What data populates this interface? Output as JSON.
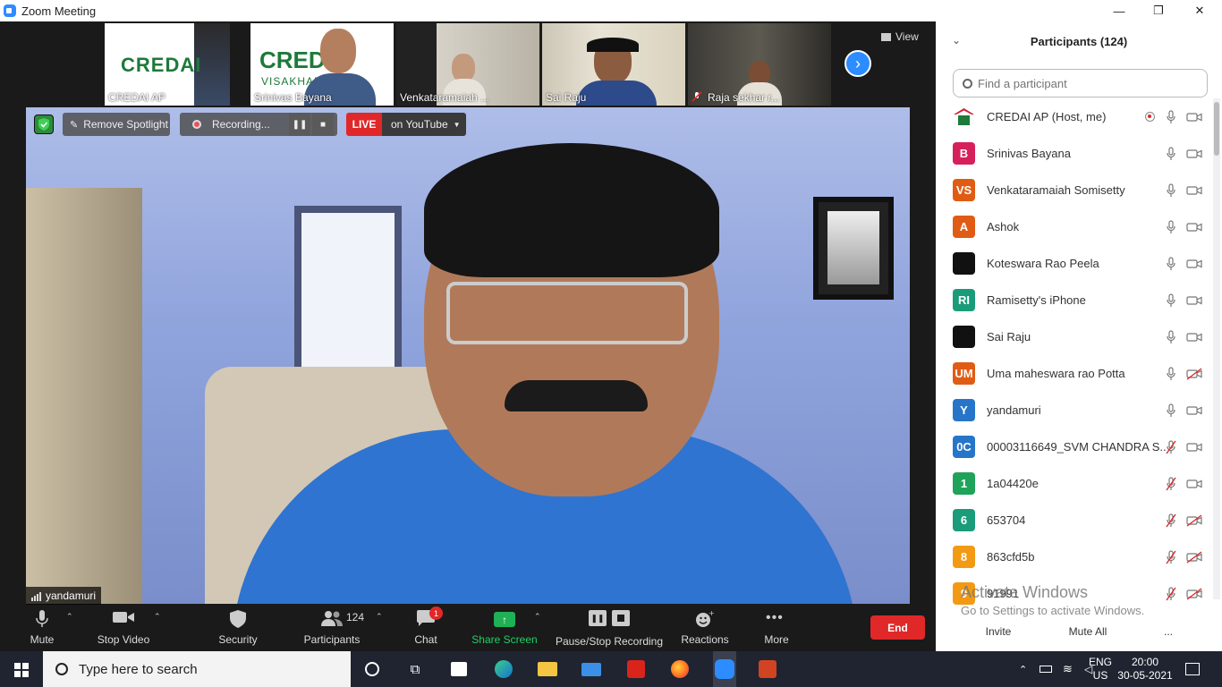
{
  "window": {
    "title": "Zoom Meeting",
    "min": "—",
    "max": "❐",
    "close": "✕"
  },
  "thumbnails": [
    {
      "name": "CREDAI AP",
      "logo": "CREDAI"
    },
    {
      "name": "Srinivas Bayana",
      "logo": "CREDAI",
      "sub": "VISAKHAPATNAM"
    },
    {
      "name": "Venkataramaiah ..."
    },
    {
      "name": "Sai Raju"
    },
    {
      "name": "Raja sekhar r..."
    }
  ],
  "view_label": "View",
  "spotlight": {
    "remove_label": "Remove Spotlight",
    "recording_label": "Recording...",
    "live_label": "LIVE",
    "youtube_label": "on YouTube"
  },
  "main_video_name": "yandamuri",
  "toolbar": {
    "mute": "Mute",
    "stop_video": "Stop Video",
    "security": "Security",
    "participants": "Participants",
    "participants_count": "124",
    "chat": "Chat",
    "chat_badge": "1",
    "share_screen": "Share Screen",
    "pause_stop_recording": "Pause/Stop Recording",
    "reactions": "Reactions",
    "more": "More",
    "end": "End"
  },
  "panel": {
    "title": "Participants (124)",
    "search_placeholder": "Find a participant",
    "participants": [
      {
        "initials": "",
        "name": "CREDAI AP (Host, me)",
        "color": "#ffffff",
        "mic": "on",
        "cam": "on",
        "rec": true,
        "logo": true
      },
      {
        "initials": "B",
        "name": "Srinivas Bayana",
        "color": "#d6205b",
        "mic": "on",
        "cam": "on"
      },
      {
        "initials": "VS",
        "name": "Venkataramaiah Somisetty",
        "color": "#e05c14",
        "mic": "on",
        "cam": "on"
      },
      {
        "initials": "A",
        "name": "Ashok",
        "color": "#e05c14",
        "mic": "on",
        "cam": "on"
      },
      {
        "initials": "",
        "name": "Koteswara Rao Peela",
        "color": "#111111",
        "mic": "on",
        "cam": "on"
      },
      {
        "initials": "RI",
        "name": "Ramisetty's iPhone",
        "color": "#1a9c7a",
        "mic": "on",
        "cam": "on"
      },
      {
        "initials": "",
        "name": "Sai Raju",
        "color": "#111111",
        "mic": "on",
        "cam": "on"
      },
      {
        "initials": "UM",
        "name": "Uma maheswara rao Potta",
        "color": "#e05c14",
        "mic": "on",
        "cam": "off"
      },
      {
        "initials": "Y",
        "name": "yandamuri",
        "color": "#2675c9",
        "mic": "on",
        "cam": "on"
      },
      {
        "initials": "0C",
        "name": "00003116649_SVM CHANDRA S...",
        "color": "#2675c9",
        "mic": "off",
        "cam": "on"
      },
      {
        "initials": "1",
        "name": "1a04420e",
        "color": "#1fa35a",
        "mic": "off",
        "cam": "on"
      },
      {
        "initials": "6",
        "name": "653704",
        "color": "#1a9c7a",
        "mic": "off",
        "cam": "off"
      },
      {
        "initials": "8",
        "name": "863cfd5b",
        "color": "#f29a14",
        "mic": "off",
        "cam": "off"
      },
      {
        "initials": "9",
        "name": "91991",
        "color": "#f29a14",
        "mic": "off",
        "cam": "off"
      }
    ],
    "invite": "Invite",
    "mute_all": "Mute All",
    "more": "..."
  },
  "activate_windows": {
    "line1": "Activate Windows",
    "line2": "Go to Settings to activate Windows."
  },
  "taskbar": {
    "search_placeholder": "Type here to search",
    "lang": "ENG",
    "region": "US",
    "time": "20:00",
    "date": "30-05-2021"
  }
}
